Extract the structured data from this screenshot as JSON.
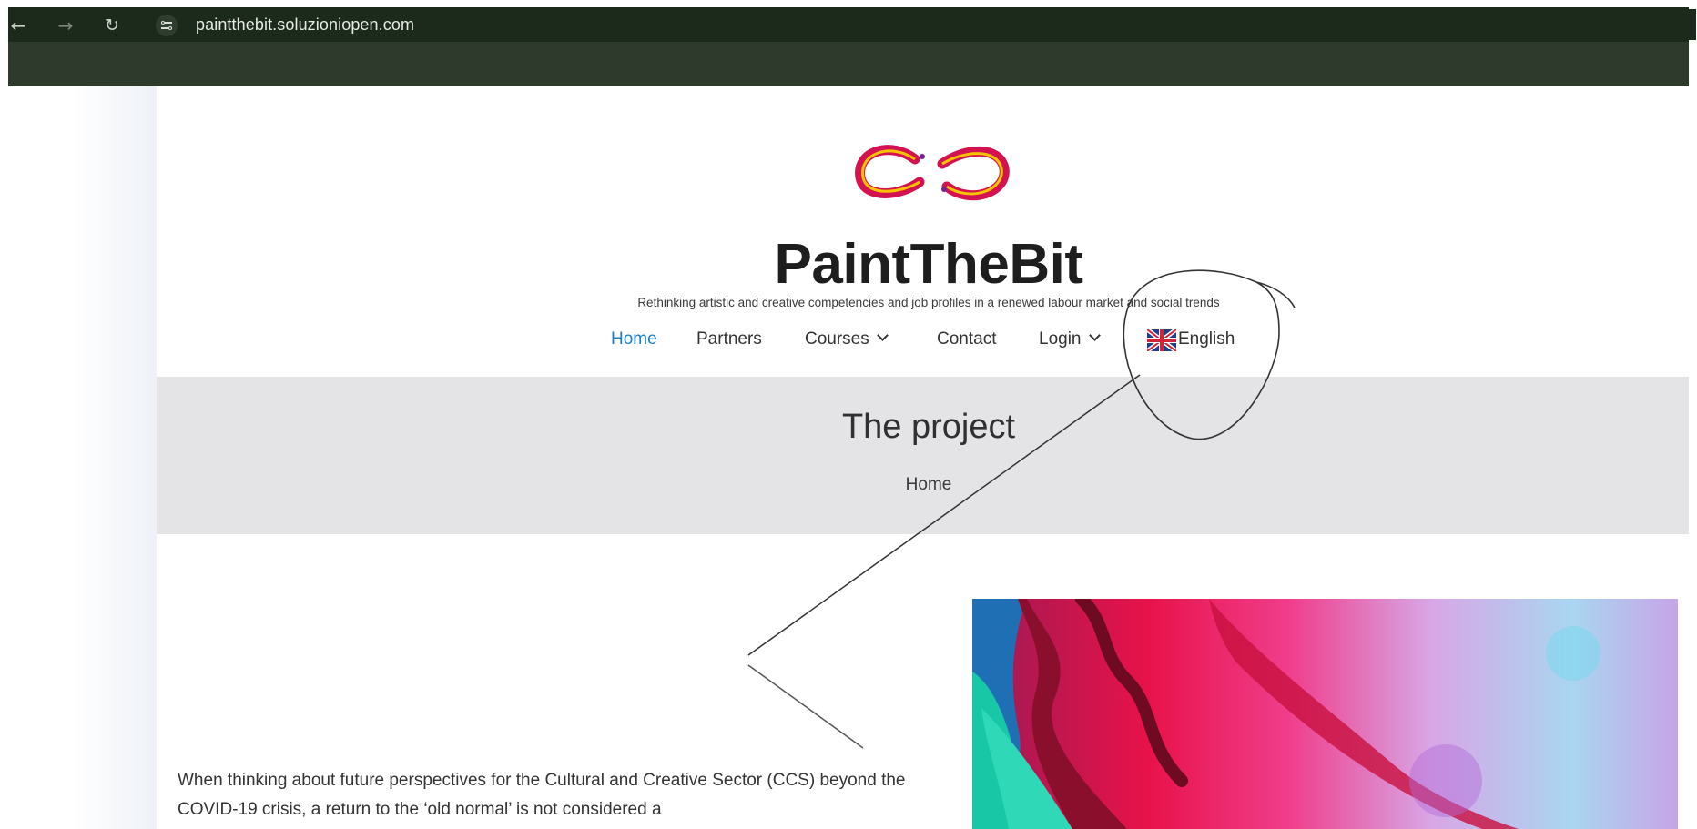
{
  "browser": {
    "url": "paintthebit.soluzioniopen.com",
    "back_icon": "arrow-left-icon",
    "forward_icon": "arrow-right-icon",
    "reload_icon": "reload-icon",
    "site_info_icon": "tune-icon"
  },
  "header": {
    "site_title": "PaintTheBit",
    "tagline": "Rethinking artistic and creative competencies and job profiles in a renewed labour market and social trends",
    "logo_icon": "paint-swirl-logo"
  },
  "menu": {
    "items": [
      {
        "label": "Home",
        "active": true
      },
      {
        "label": "Partners"
      },
      {
        "label": "Courses",
        "dropdown": true
      },
      {
        "label": "Contact"
      },
      {
        "label": "Login",
        "dropdown": true
      },
      {
        "label": "English",
        "icon": "uk-flag-icon"
      }
    ]
  },
  "banner": {
    "title": "The project",
    "breadcrumb": "Home"
  },
  "content": {
    "paragraph": "When thinking about future perspectives for the Cultural and Creative Sector (CCS) beyond the COVID-19 crisis, a return to the ‘old normal’ is not considered a"
  },
  "colors": {
    "chrome_dark": "#1c2a1c",
    "chrome_toolbar": "#2e3a2c",
    "accent_link": "#1c7fc4",
    "banner_bg": "#e4e4e6",
    "annotation_stroke": "#333333"
  }
}
